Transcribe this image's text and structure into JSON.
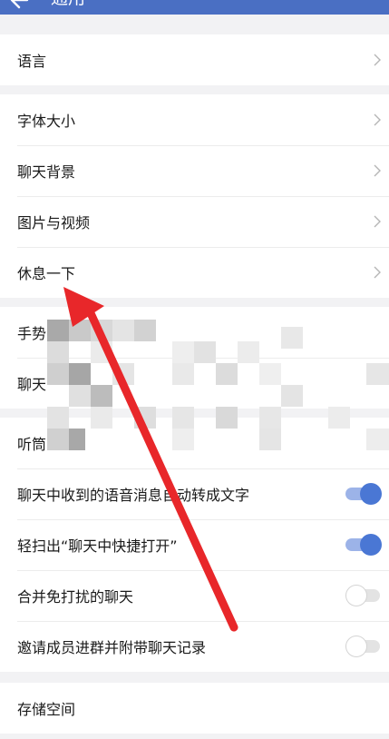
{
  "header": {
    "title": "通用",
    "back_icon": "arrow-left-icon"
  },
  "groups": [
    {
      "items": [
        {
          "label": "语言",
          "type": "chevron"
        }
      ]
    },
    {
      "items": [
        {
          "label": "字体大小",
          "type": "chevron"
        },
        {
          "label": "聊天背景",
          "type": "chevron"
        },
        {
          "label": "图片与视频",
          "type": "chevron"
        },
        {
          "label": "休息一下",
          "type": "chevron"
        }
      ]
    },
    {
      "items": [
        {
          "label": "手势",
          "type": "none"
        },
        {
          "label": "聊天",
          "type": "none"
        }
      ]
    },
    {
      "items": [
        {
          "label": "听筒",
          "type": "none"
        },
        {
          "label": "聊天中收到的语音消息自动转成文字",
          "type": "toggle",
          "on": true
        },
        {
          "label": "轻扫出“聊天中快捷打开”",
          "type": "toggle",
          "on": true
        },
        {
          "label": "合并免打扰的聊天",
          "type": "toggle",
          "on": false
        },
        {
          "label": "邀请成员进群并附带聊天记录",
          "type": "toggle",
          "on": false
        }
      ]
    },
    {
      "items": [
        {
          "label": "存储空间",
          "type": "none"
        }
      ]
    }
  ],
  "colors": {
    "accent": "#4a77d4",
    "header": "#4a6fc3",
    "annotation_arrow": "#e8272a"
  }
}
